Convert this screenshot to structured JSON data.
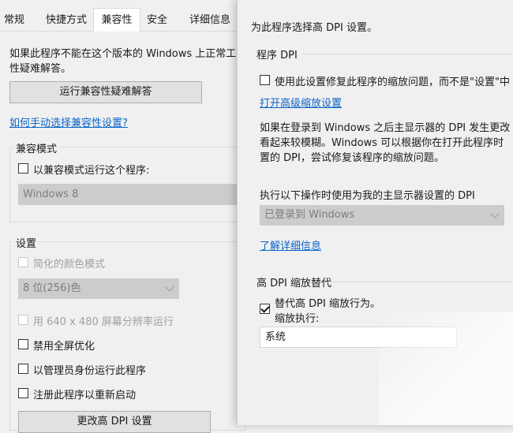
{
  "tabs": [
    "常规",
    "快捷方式",
    "兼容性",
    "安全",
    "详细信息"
  ],
  "back": {
    "intro": "如果此程序不能在这个版本的 Windows 上正常工",
    "intro2": "性疑难解答。",
    "run_troubleshooter": "运行兼容性疑难解答",
    "manual_link": "如何手动选择兼容性设置?",
    "compat_mode_title": "兼容模式",
    "compat_mode_checkbox": "以兼容模式运行这个程序:",
    "compat_os": "Windows 8",
    "settings_title": "设置",
    "reduced_color": "简化的颜色模式",
    "color_depth": "8 位(256)色",
    "run_640": "用 640 x 480 屏幕分辨率运行",
    "disable_fullscreen": "禁用全屏优化",
    "run_as_admin": "以管理员身份运行此程序",
    "register_restart": "注册此程序以重新启动",
    "change_dpi": "更改高 DPI 设置"
  },
  "dialog": {
    "heading": "为此程序选择高 DPI 设置。",
    "program_dpi_title": "程序 DPI",
    "use_setting_checkbox": "使用此设置修复此程序的缩放问题，而不是\"设置\"中",
    "open_advanced_link": "打开高级缩放设置",
    "desc_line1": "如果在登录到 Windows 之后主显示器的 DPI 发生更改",
    "desc_line2": "看起来较模糊。Windows 可以根据你在打开此程序时",
    "desc_line3": "置的 DPI，尝试修复该程序的缩放问题。",
    "use_dpi_label": "执行以下操作时使用为我的主显示器设置的 DPI",
    "dpi_select": "已登录到 Windows",
    "learn_more_link": "了解详细信息",
    "override_title": "高 DPI 缩放替代",
    "override_checkbox": "替代高 DPI 缩放行为。",
    "scaling_performed_by": "缩放执行:",
    "scaling_select": "系统"
  },
  "colors": {
    "link": "#0a64c8",
    "disabled": "#a0a0a0"
  }
}
